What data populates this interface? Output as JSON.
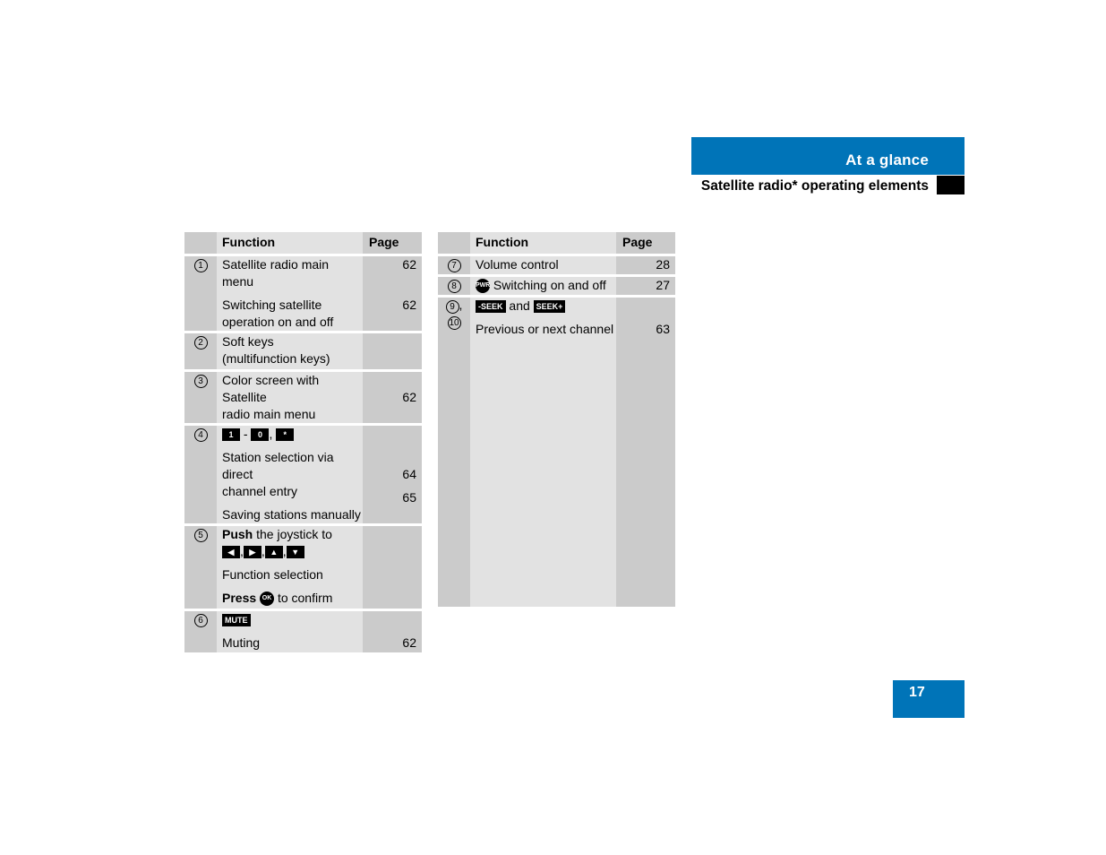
{
  "header": {
    "section": "At a glance",
    "subtitle": "Satellite radio* operating elements"
  },
  "page_number": "17",
  "colors": {
    "accent": "#0074b8",
    "num_col": "#cbcbcb",
    "fn_col": "#e2e2e2"
  },
  "left_table": {
    "headers": {
      "function": "Function",
      "page": "Page"
    },
    "rows": [
      {
        "num": "1",
        "items": [
          {
            "text": "Satellite radio main menu",
            "page": "62"
          },
          {
            "text": "Switching satellite operation on and off",
            "line1": "Switching satellite",
            "line2": "operation on and off",
            "page": "62"
          }
        ]
      },
      {
        "num": "2",
        "line1": "Soft keys",
        "line2": "(multifunction keys)"
      },
      {
        "num": "3",
        "line1": "Color screen with Satellite",
        "line2": "radio main menu",
        "page": "62"
      },
      {
        "num": "4",
        "keys": {
          "k1": "1",
          "dash": "-",
          "k0": "0",
          "comma": ",",
          "star": "*"
        },
        "item1": {
          "line1": "Station selection via direct",
          "line2": "channel entry",
          "page": "64"
        },
        "item2": {
          "text": "Saving stations manually",
          "page": "65"
        }
      },
      {
        "num": "5",
        "push_bold": "Push",
        "push_rest": "the joystick to",
        "arrows": [
          "◀",
          "▶",
          "▲",
          "▼"
        ],
        "function_selection": "Function selection",
        "press_bold": "Press",
        "ok_key": "OK",
        "press_rest": "to confirm"
      },
      {
        "num": "6",
        "key": "MUTE",
        "text": "Muting",
        "page": "62"
      }
    ]
  },
  "right_table": {
    "headers": {
      "function": "Function",
      "page": "Page"
    },
    "rows": [
      {
        "num": "7",
        "text": "Volume control",
        "page": "28"
      },
      {
        "num": "8",
        "key": "PWR",
        "text": "Switching on and off",
        "page": "27"
      },
      {
        "num": "9",
        "num2": "10",
        "sep": ",",
        "key1": "-SEEK",
        "and": "and",
        "key2": "SEEK+",
        "text": "Previous or next channel",
        "page": "63"
      }
    ]
  }
}
